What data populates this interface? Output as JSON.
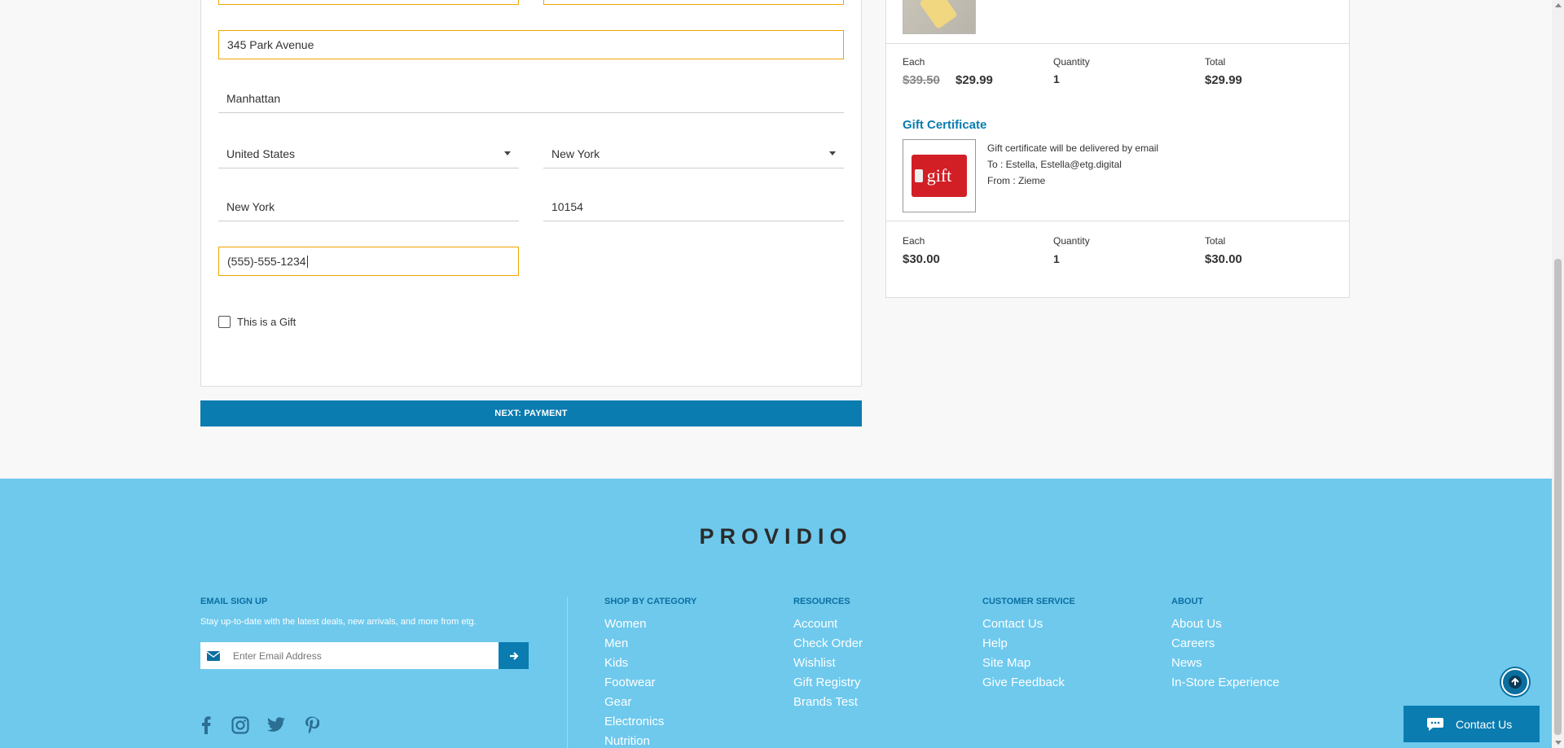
{
  "form": {
    "address1": "345 Park Avenue",
    "address2": "Manhattan",
    "country": "United States",
    "state": "New York",
    "city": "New York",
    "zip": "10154",
    "phone": "(555)-555-1234",
    "gift_label": "This is a Gift",
    "next_button": "NEXT: PAYMENT"
  },
  "summary": {
    "item1": {
      "each_label": "Each",
      "original_price": "$39.50",
      "sale_price": "$29.99",
      "quantity_label": "Quantity",
      "quantity": "1",
      "total_label": "Total",
      "total": "$29.99"
    },
    "gift_certificate": {
      "title": "Gift Certificate",
      "card_text": "gift",
      "line1": "Gift certificate will be delivered by email",
      "line2": "To : Estella, Estella@etg.digital",
      "line3": "From : Zieme",
      "each_label": "Each",
      "each": "$30.00",
      "quantity_label": "Quantity",
      "quantity": "1",
      "total_label": "Total",
      "total": "$30.00"
    }
  },
  "footer": {
    "logo": "PROVIDIO",
    "email_heading": "EMAIL SIGN UP",
    "email_text": "Stay up-to-date with the latest deals, new arrivals, and more from etg.",
    "email_placeholder": "Enter Email Address",
    "columns": [
      {
        "heading": "SHOP BY CATEGORY",
        "links": [
          "Women",
          "Men",
          "Kids",
          "Footwear",
          "Gear",
          "Electronics",
          "Nutrition"
        ]
      },
      {
        "heading": "RESOURCES",
        "links": [
          "Account",
          "Check Order",
          "Wishlist",
          "Gift Registry",
          "Brands Test"
        ]
      },
      {
        "heading": "CUSTOMER SERVICE",
        "links": [
          "Contact Us",
          "Help",
          "Site Map",
          "Give Feedback"
        ]
      },
      {
        "heading": "ABOUT",
        "links": [
          "About Us",
          "Careers",
          "News",
          "In-Store Experience"
        ]
      }
    ],
    "social_icons": [
      "facebook-icon",
      "instagram-icon",
      "twitter-icon",
      "pinterest-icon"
    ]
  },
  "chat": {
    "label": "Contact Us"
  },
  "colors": {
    "accent": "#0a7cb0",
    "footer_bg": "#6ec9ed",
    "focus": "#f0a500"
  }
}
